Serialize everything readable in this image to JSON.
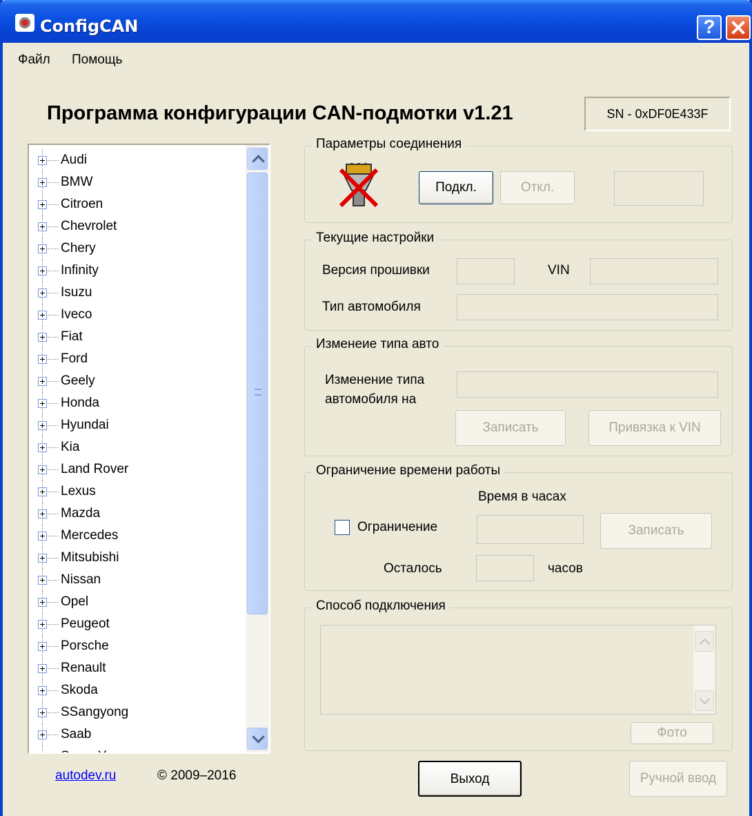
{
  "window": {
    "title": "ConfigCAN",
    "help_label": "?"
  },
  "menu": {
    "items": [
      "Файл",
      "Помощь"
    ]
  },
  "header": {
    "title": "Программа конфигурации CAN-подмотки v1.21",
    "serial": "SN - 0xDF0E433F"
  },
  "tree": {
    "items": [
      "Audi",
      "BMW",
      "Citroen",
      "Chevrolet",
      "Chery",
      "Infinity",
      "Isuzu",
      "Iveco",
      "Fiat",
      "Ford",
      "Geely",
      "Honda",
      "Hyundai",
      "Kia",
      "Land Rover",
      "Lexus",
      "Mazda",
      "Mercedes",
      "Mitsubishi",
      "Nissan",
      "Opel",
      "Peugeot",
      "Porsche",
      "Renault",
      "Skoda",
      "SSangyong",
      "Saab",
      "SsangYong"
    ]
  },
  "connection": {
    "label": "Параметры соединения",
    "connect_label": "Подкл.",
    "disconnect_label": "Откл.",
    "status_value": ""
  },
  "current": {
    "label": "Текущие настройки",
    "firmware_label": "Версия прошивки",
    "firmware_value": "",
    "vin_label": "VIN",
    "vin_value": "",
    "car_type_label": "Тип автомобиля",
    "car_type_value": ""
  },
  "change_type": {
    "label": "Изменеие типа авто",
    "field_label_line1": "Изменение типа",
    "field_label_line2": "автомобиля на",
    "field_value": "",
    "write_label": "Записать",
    "bind_vin_label": "Привязка к VIN"
  },
  "time_limit": {
    "label": "Ограничение времени работы",
    "hours_label": "Время в часах",
    "checkbox_label": "Ограничение",
    "hours_value": "",
    "write_label": "Записать",
    "remaining_label": "Осталось",
    "remaining_value": "",
    "hours_unit": "часов"
  },
  "connection_method": {
    "label": "Способ подключения",
    "text": "",
    "photo_label": "Фото"
  },
  "footer": {
    "link": "autodev.ru",
    "copyright": "© 2009–2016",
    "exit_label": "Выход",
    "manual_label": "Ручной ввод"
  },
  "colors": {
    "titlebar": "#0A4FE0",
    "window_bg": "#ECE9D8",
    "link": "#0000FF",
    "disabled_text": "#ACA899",
    "error_cross": "#E00000"
  },
  "icons": {
    "app": "configcan-app-icon",
    "plug": "disconnected-plug-icon"
  }
}
